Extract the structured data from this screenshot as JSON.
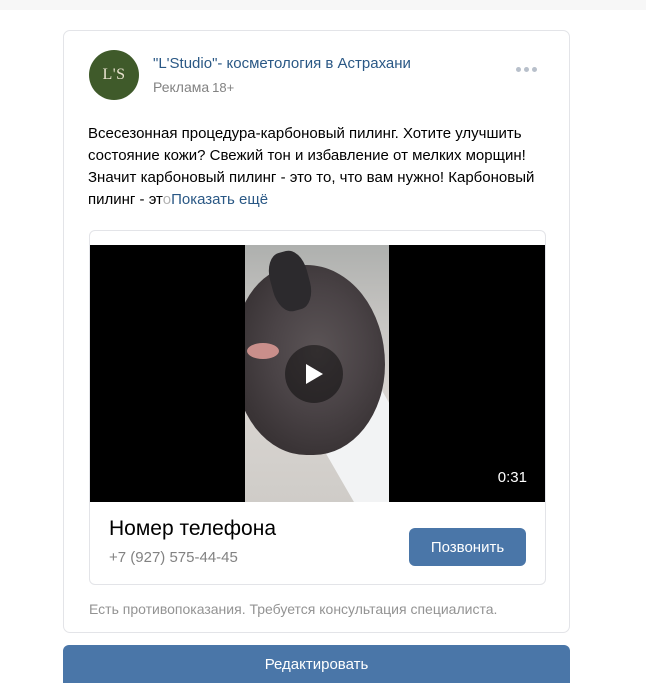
{
  "post": {
    "avatar_text": "L'S",
    "author": "\"L'Studio\"- косметология в Астрахани",
    "meta_label": "Реклама",
    "age_rating": "18+",
    "text": "Всесезонная процедура-карбоновый пилинг. Хотите улучшить состояние кожи? Свежий тон и избавление от мелких морщин!Значит карбоновый пилинг - это то, что вам нужно! Карбоновый пилинг - эт",
    "text_fade": "о",
    "show_more": "Показать ещё"
  },
  "attachment": {
    "video_duration": "0:31",
    "phone_title": "Номер телефона",
    "phone_number": "+7 (927) 575-44-45",
    "call_button": "Позвонить"
  },
  "disclaimer": "Есть противопоказания. Требуется консультация специалиста.",
  "edit_button": "Редактировать",
  "icons": {
    "more": "more-horizontal-icon",
    "play": "play-icon"
  },
  "colors": {
    "link": "#2a5885",
    "button": "#4a76a8",
    "avatar": "#3f5a2a"
  }
}
